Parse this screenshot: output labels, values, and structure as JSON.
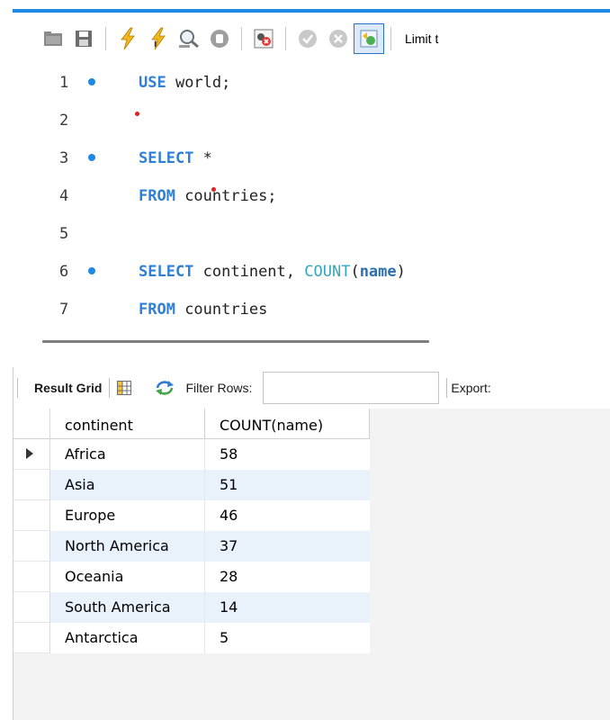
{
  "toolbar": {
    "limit_label": "Limit t",
    "icons": [
      "folder-icon",
      "save-icon",
      "execute-icon",
      "execute-current-icon",
      "explain-icon",
      "stop-icon",
      "toggle-error-icon",
      "commit-icon",
      "rollback-icon",
      "autocommit-icon"
    ]
  },
  "editor": {
    "lines": [
      {
        "num": "1",
        "marker": true,
        "tokens": [
          {
            "t": "USE",
            "c": "kw"
          },
          {
            "t": " world;",
            "c": ""
          }
        ]
      },
      {
        "num": "2",
        "marker": false,
        "tokens": []
      },
      {
        "num": "3",
        "marker": true,
        "tokens": [
          {
            "t": "SELECT",
            "c": "kw"
          },
          {
            "t": " *",
            "c": ""
          }
        ]
      },
      {
        "num": "4",
        "marker": false,
        "tokens": [
          {
            "t": "FROM",
            "c": "kw"
          },
          {
            "t": " countries;",
            "c": ""
          }
        ]
      },
      {
        "num": "5",
        "marker": false,
        "tokens": []
      },
      {
        "num": "6",
        "marker": true,
        "tokens": [
          {
            "t": "SELECT",
            "c": "kw"
          },
          {
            "t": " continent, ",
            "c": ""
          },
          {
            "t": "COUNT",
            "c": "fn"
          },
          {
            "t": "(",
            "c": ""
          },
          {
            "t": "name",
            "c": "ident-bold"
          },
          {
            "t": ")",
            "c": ""
          }
        ]
      },
      {
        "num": "7",
        "marker": false,
        "tokens": [
          {
            "t": "FROM",
            "c": "kw"
          },
          {
            "t": " countries",
            "c": ""
          }
        ]
      }
    ]
  },
  "results": {
    "result_grid_label": "Result Grid",
    "filter_rows_label": "Filter Rows:",
    "filter_value": "",
    "export_label": "Export:",
    "columns": [
      "continent",
      "COUNT(name)"
    ],
    "rows": [
      {
        "continent": "Africa",
        "count": "58"
      },
      {
        "continent": "Asia",
        "count": "51"
      },
      {
        "continent": "Europe",
        "count": "46"
      },
      {
        "continent": "North America",
        "count": "37"
      },
      {
        "continent": "Oceania",
        "count": "28"
      },
      {
        "continent": "South America",
        "count": "14"
      },
      {
        "continent": "Antarctica",
        "count": "5"
      }
    ]
  },
  "colors": {
    "accent": "#1e88e5",
    "keyword": "#2e7fd6",
    "row_alt": "#e9f1fb"
  }
}
